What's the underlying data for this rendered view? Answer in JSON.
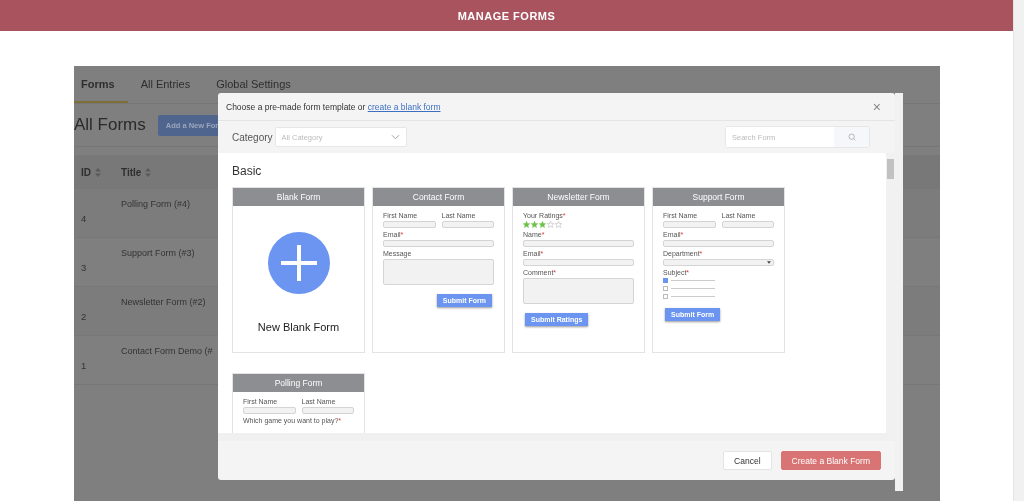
{
  "header": {
    "title": "MANAGE FORMS"
  },
  "tabs": [
    {
      "label": "Forms",
      "selected": true
    },
    {
      "label": "All Entries",
      "selected": false
    },
    {
      "label": "Global Settings",
      "selected": false
    }
  ],
  "page_title": "All Forms",
  "add_button": "Add a New For",
  "table": {
    "columns": [
      "ID",
      "Title"
    ],
    "rows": [
      {
        "id": "4",
        "title": "Polling Form (#4)"
      },
      {
        "id": "3",
        "title": "Support Form (#3)"
      },
      {
        "id": "2",
        "title": "Newsletter Form (#2)"
      },
      {
        "id": "1",
        "title": "Contact Form Demo (#"
      }
    ]
  },
  "modal": {
    "intro": "Choose a pre-made form template or",
    "link": "create a blank form",
    "close": "×",
    "category_label": "Category",
    "category_placeholder": "All Category",
    "search_placeholder": "Search Form",
    "section": "Basic",
    "templates": [
      {
        "title": "Blank Form",
        "kind": "blank",
        "label": "New Blank Form"
      },
      {
        "title": "Contact Form",
        "kind": "form",
        "fields": [
          {
            "kind": "pair",
            "labels": [
              "First Name",
              "Last Name"
            ]
          },
          {
            "kind": "input",
            "label": "Email",
            "mark": "*"
          },
          {
            "kind": "textarea",
            "label": "Message"
          }
        ],
        "button": "Submit Form"
      },
      {
        "title": "Newsletter Form",
        "kind": "form",
        "fields": [
          {
            "kind": "stars",
            "label": "Your Ratings",
            "mark": "*",
            "stars": 3
          },
          {
            "kind": "input",
            "label": "Name",
            "mark": "*"
          },
          {
            "kind": "input",
            "label": "Email",
            "mark": "*"
          },
          {
            "kind": "textarea",
            "label": "Comment",
            "mark": "*"
          }
        ],
        "button": "Submit Ratings"
      },
      {
        "title": "Support Form",
        "kind": "form",
        "fields": [
          {
            "kind": "pair",
            "labels": [
              "First Name",
              "Last Name"
            ]
          },
          {
            "kind": "input",
            "label": "Email",
            "mark": "*"
          },
          {
            "kind": "select",
            "label": "Department",
            "mark": "*"
          },
          {
            "kind": "checks",
            "label": "Subject",
            "mark": "*",
            "checks": [
              {
                "checked": true
              },
              {
                "checked": false
              },
              {
                "checked": false
              }
            ]
          }
        ],
        "button": "Submit Form"
      },
      {
        "title": "Polling Form",
        "kind": "form",
        "fields": [
          {
            "kind": "pair",
            "labels": [
              "First Name",
              "Last Name"
            ]
          },
          {
            "kind": "question",
            "label": "Which game you want to play?",
            "mark": "*"
          }
        ]
      }
    ],
    "buttons": [
      {
        "label": "Cancel",
        "kind": "secondary"
      },
      {
        "label": "Create a Blank Form",
        "kind": "primary"
      }
    ]
  }
}
